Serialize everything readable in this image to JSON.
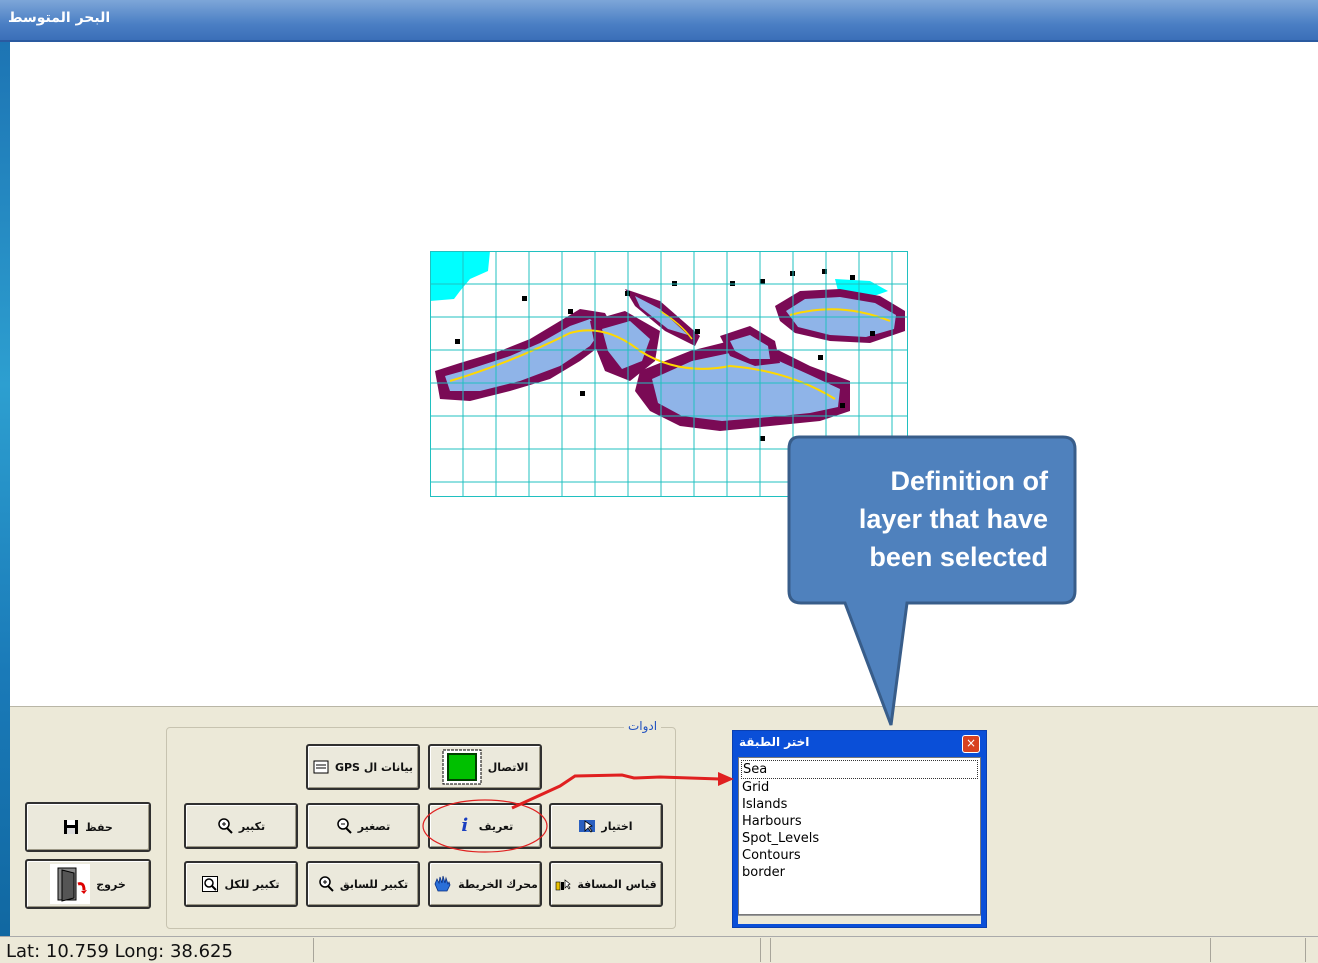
{
  "window": {
    "title": "البحر المتوسط"
  },
  "tools_group": {
    "label": "ادوات"
  },
  "buttons": {
    "gps_data": "بيانات ال GPS",
    "connect": "الاتصال",
    "zoom_in": "تكبير",
    "zoom_out": "تصغير",
    "identify": "تعريف",
    "select": "اختيار",
    "zoom_full": "تكبير للكل",
    "zoom_previous": "تكبير للسابق",
    "pan": "محرك الخريطة",
    "measure": "قياس المسافة",
    "save": "حفظ",
    "exit": "خروج"
  },
  "layer_window": {
    "title": "اختر الطبقة",
    "close": "×",
    "items": [
      "Sea",
      "Grid",
      "Islands",
      "Harbours",
      "Spot_Levels",
      "Contours",
      "border"
    ],
    "selected": "Sea"
  },
  "callout": {
    "text_lines": [
      "Definition of",
      "layer that have",
      "been selected"
    ],
    "color": "#4f81bd"
  },
  "status": {
    "coords": "Lat: 10.759 Long: 38.625"
  },
  "icons": {
    "gps_data": "gps-icon",
    "connect": "connect-icon",
    "zoom_in": "zoom-in-icon",
    "zoom_out": "zoom-out-icon",
    "identify": "info-icon",
    "select": "select-cursor-icon",
    "zoom_full": "zoom-full-icon",
    "zoom_previous": "zoom-previous-icon",
    "pan": "hand-icon",
    "measure": "ruler-icon",
    "save": "floppy-disk-icon",
    "exit": "exit-door-icon"
  }
}
